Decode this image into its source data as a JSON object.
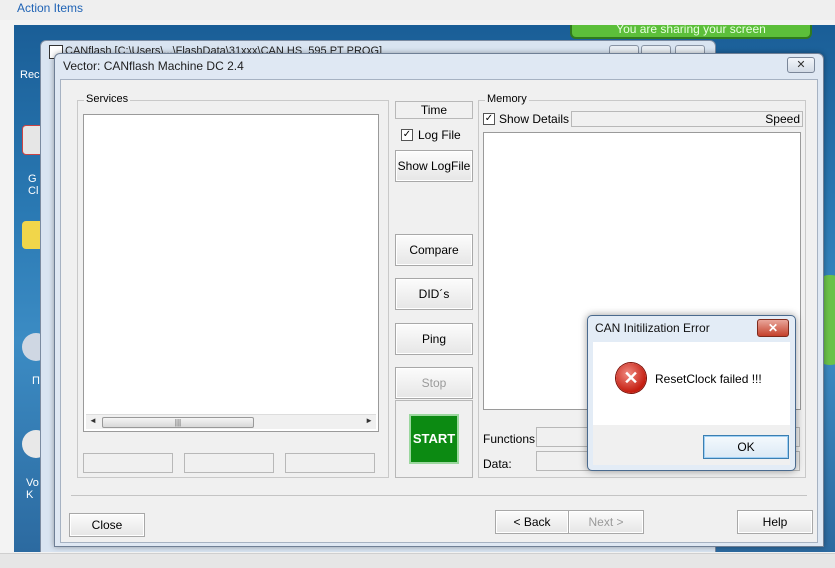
{
  "outer": {
    "action_items_label": "Action Items"
  },
  "desktop": {
    "share_banner": "You are sharing your screen",
    "icon_labels": [
      "Rec",
      "G Cl",
      "Π",
      "Vo K"
    ]
  },
  "background_window": {
    "title": "CANflash [C:\\Users\\...\\FlashData\\31xxx\\CAN HS_595 PT PROG]"
  },
  "dialog": {
    "title": "Vector: CANflash Machine DC 2.4",
    "close_glyph": "✕",
    "services": {
      "label": "Services",
      "scroll_left": "◄",
      "scroll_right": "►",
      "thumb_grip": "|||"
    },
    "time": {
      "label": "Time",
      "log_file_label": "Log File",
      "log_file_checked": true,
      "check_glyph": "✓",
      "show_logfile_label": "Show LogFile"
    },
    "actions": {
      "compare": "Compare",
      "dids": "DID´s",
      "ping": "Ping",
      "stop": "Stop",
      "start": "START",
      "start_color": "#0c8a12"
    },
    "memory": {
      "label": "Memory",
      "show_details_label": "Show Details",
      "show_details_checked": true,
      "speed_label": "Speed",
      "functions_label": "Functions:",
      "data_label": "Data:"
    },
    "footer": {
      "close": "Close",
      "back": "< Back",
      "next": "Next >",
      "help": "Help"
    }
  },
  "error_dialog": {
    "title": "CAN Initilization Error",
    "close_glyph": "✕",
    "icon_glyph": "✕",
    "message": "ResetClock failed !!!",
    "ok_label": "OK"
  }
}
